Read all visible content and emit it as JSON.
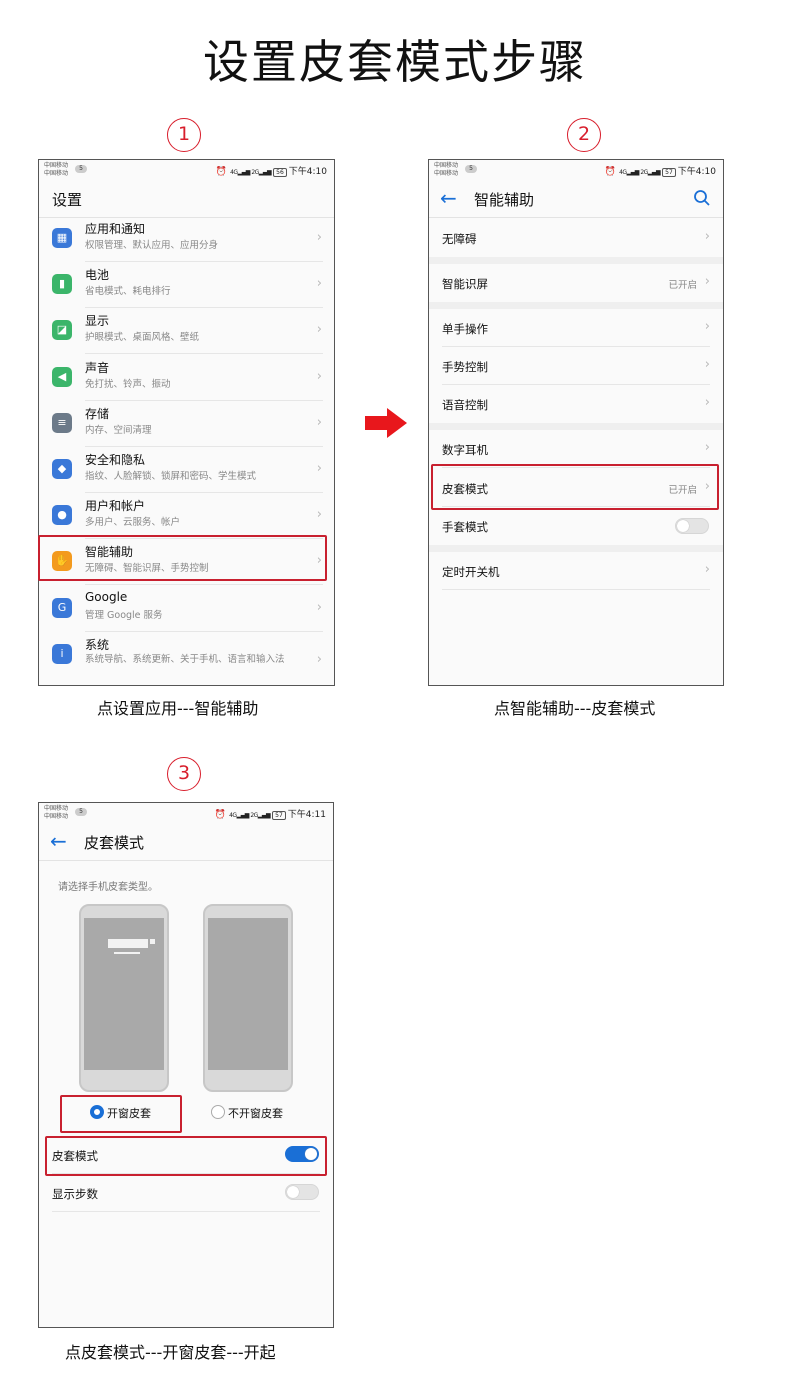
{
  "title": "设置皮套模式步骤",
  "steps": [
    "1",
    "2",
    "3"
  ],
  "captions": [
    "点设置应用---智能辅助",
    "点智能辅助---皮套模式",
    "点皮套模式---开窗皮套---开起"
  ],
  "status_bar": {
    "carrier_line1": "中国移动",
    "carrier_line2": "中国移动",
    "sim_badge": "5",
    "signal1": "4G",
    "signal2": "2G",
    "screen1": {
      "battery": "56",
      "time": "下午4:10"
    },
    "screen2": {
      "battery": "57",
      "time": "下午4:10"
    },
    "screen3": {
      "battery": "57",
      "time": "下午4:11"
    }
  },
  "screen1": {
    "title": "设置",
    "items": [
      {
        "title": "应用和通知",
        "sub": "权限管理、默认应用、应用分身",
        "icon": "apps-icon",
        "color": "#3a78d8",
        "glyph": "▦"
      },
      {
        "title": "电池",
        "sub": "省电模式、耗电排行",
        "icon": "battery-icon",
        "color": "#3bb56a",
        "glyph": "▮"
      },
      {
        "title": "显示",
        "sub": "护眼模式、桌面风格、壁纸",
        "icon": "display-icon",
        "color": "#3bb56a",
        "glyph": "◪"
      },
      {
        "title": "声音",
        "sub": "免打扰、铃声、振动",
        "icon": "sound-icon",
        "color": "#3bb56a",
        "glyph": "◀"
      },
      {
        "title": "存储",
        "sub": "内存、空间清理",
        "icon": "storage-icon",
        "color": "#6c7a89",
        "glyph": "≡"
      },
      {
        "title": "安全和隐私",
        "sub": "指纹、人脸解锁、锁屏和密码、学生模式",
        "icon": "shield-icon",
        "color": "#3a78d8",
        "glyph": "◆"
      },
      {
        "title": "用户和帐户",
        "sub": "多用户、云服务、帐户",
        "icon": "user-icon",
        "color": "#3a78d8",
        "glyph": "●"
      },
      {
        "title": "智能辅助",
        "sub": "无障碍、智能识屏、手势控制",
        "icon": "hand-icon",
        "color": "#f39a1e",
        "glyph": "✋"
      },
      {
        "title": "Google",
        "sub": "管理 Google 服务",
        "icon": "google-icon",
        "color": "#3a78d8",
        "glyph": "G"
      },
      {
        "title": "系统",
        "sub": "系统导航、系统更新、关于手机、语言和输入法",
        "icon": "system-icon",
        "color": "#3a78d8",
        "glyph": "i"
      }
    ]
  },
  "screen2": {
    "title": "智能辅助",
    "items": [
      {
        "label": "无障碍",
        "value": ""
      },
      {
        "label": "智能识屏",
        "value": "已开启"
      },
      {
        "label": "单手操作",
        "value": ""
      },
      {
        "label": "手势控制",
        "value": ""
      },
      {
        "label": "语音控制",
        "value": ""
      },
      {
        "label": "数字耳机",
        "value": ""
      },
      {
        "label": "皮套模式",
        "value": "已开启"
      },
      {
        "label": "手套模式",
        "value": "",
        "toggle": false
      },
      {
        "label": "定时开关机",
        "value": ""
      }
    ]
  },
  "screen3": {
    "title": "皮套模式",
    "hint": "请选择手机皮套类型。",
    "options": [
      {
        "label": "开窗皮套",
        "selected": true
      },
      {
        "label": "不开窗皮套",
        "selected": false
      }
    ],
    "rows": [
      {
        "label": "皮套模式",
        "toggle": true
      },
      {
        "label": "显示步数",
        "toggle": false
      }
    ]
  },
  "colors": {
    "accent": "#1a6fd6",
    "highlight": "#c8202f",
    "arrow": "#e8171c"
  }
}
